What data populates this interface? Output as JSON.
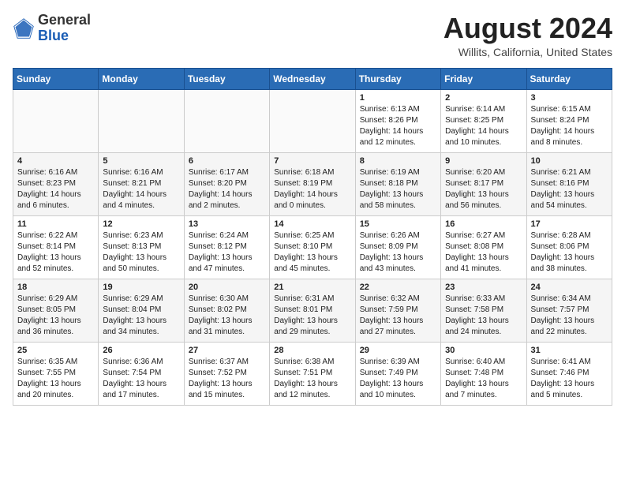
{
  "logo": {
    "general": "General",
    "blue": "Blue"
  },
  "title": "August 2024",
  "location": "Willits, California, United States",
  "days_of_week": [
    "Sunday",
    "Monday",
    "Tuesday",
    "Wednesday",
    "Thursday",
    "Friday",
    "Saturday"
  ],
  "weeks": [
    [
      {
        "day": "",
        "info": ""
      },
      {
        "day": "",
        "info": ""
      },
      {
        "day": "",
        "info": ""
      },
      {
        "day": "",
        "info": ""
      },
      {
        "day": "1",
        "info": "Sunrise: 6:13 AM\nSunset: 8:26 PM\nDaylight: 14 hours\nand 12 minutes."
      },
      {
        "day": "2",
        "info": "Sunrise: 6:14 AM\nSunset: 8:25 PM\nDaylight: 14 hours\nand 10 minutes."
      },
      {
        "day": "3",
        "info": "Sunrise: 6:15 AM\nSunset: 8:24 PM\nDaylight: 14 hours\nand 8 minutes."
      }
    ],
    [
      {
        "day": "4",
        "info": "Sunrise: 6:16 AM\nSunset: 8:23 PM\nDaylight: 14 hours\nand 6 minutes."
      },
      {
        "day": "5",
        "info": "Sunrise: 6:16 AM\nSunset: 8:21 PM\nDaylight: 14 hours\nand 4 minutes."
      },
      {
        "day": "6",
        "info": "Sunrise: 6:17 AM\nSunset: 8:20 PM\nDaylight: 14 hours\nand 2 minutes."
      },
      {
        "day": "7",
        "info": "Sunrise: 6:18 AM\nSunset: 8:19 PM\nDaylight: 14 hours\nand 0 minutes."
      },
      {
        "day": "8",
        "info": "Sunrise: 6:19 AM\nSunset: 8:18 PM\nDaylight: 13 hours\nand 58 minutes."
      },
      {
        "day": "9",
        "info": "Sunrise: 6:20 AM\nSunset: 8:17 PM\nDaylight: 13 hours\nand 56 minutes."
      },
      {
        "day": "10",
        "info": "Sunrise: 6:21 AM\nSunset: 8:16 PM\nDaylight: 13 hours\nand 54 minutes."
      }
    ],
    [
      {
        "day": "11",
        "info": "Sunrise: 6:22 AM\nSunset: 8:14 PM\nDaylight: 13 hours\nand 52 minutes."
      },
      {
        "day": "12",
        "info": "Sunrise: 6:23 AM\nSunset: 8:13 PM\nDaylight: 13 hours\nand 50 minutes."
      },
      {
        "day": "13",
        "info": "Sunrise: 6:24 AM\nSunset: 8:12 PM\nDaylight: 13 hours\nand 47 minutes."
      },
      {
        "day": "14",
        "info": "Sunrise: 6:25 AM\nSunset: 8:10 PM\nDaylight: 13 hours\nand 45 minutes."
      },
      {
        "day": "15",
        "info": "Sunrise: 6:26 AM\nSunset: 8:09 PM\nDaylight: 13 hours\nand 43 minutes."
      },
      {
        "day": "16",
        "info": "Sunrise: 6:27 AM\nSunset: 8:08 PM\nDaylight: 13 hours\nand 41 minutes."
      },
      {
        "day": "17",
        "info": "Sunrise: 6:28 AM\nSunset: 8:06 PM\nDaylight: 13 hours\nand 38 minutes."
      }
    ],
    [
      {
        "day": "18",
        "info": "Sunrise: 6:29 AM\nSunset: 8:05 PM\nDaylight: 13 hours\nand 36 minutes."
      },
      {
        "day": "19",
        "info": "Sunrise: 6:29 AM\nSunset: 8:04 PM\nDaylight: 13 hours\nand 34 minutes."
      },
      {
        "day": "20",
        "info": "Sunrise: 6:30 AM\nSunset: 8:02 PM\nDaylight: 13 hours\nand 31 minutes."
      },
      {
        "day": "21",
        "info": "Sunrise: 6:31 AM\nSunset: 8:01 PM\nDaylight: 13 hours\nand 29 minutes."
      },
      {
        "day": "22",
        "info": "Sunrise: 6:32 AM\nSunset: 7:59 PM\nDaylight: 13 hours\nand 27 minutes."
      },
      {
        "day": "23",
        "info": "Sunrise: 6:33 AM\nSunset: 7:58 PM\nDaylight: 13 hours\nand 24 minutes."
      },
      {
        "day": "24",
        "info": "Sunrise: 6:34 AM\nSunset: 7:57 PM\nDaylight: 13 hours\nand 22 minutes."
      }
    ],
    [
      {
        "day": "25",
        "info": "Sunrise: 6:35 AM\nSunset: 7:55 PM\nDaylight: 13 hours\nand 20 minutes."
      },
      {
        "day": "26",
        "info": "Sunrise: 6:36 AM\nSunset: 7:54 PM\nDaylight: 13 hours\nand 17 minutes."
      },
      {
        "day": "27",
        "info": "Sunrise: 6:37 AM\nSunset: 7:52 PM\nDaylight: 13 hours\nand 15 minutes."
      },
      {
        "day": "28",
        "info": "Sunrise: 6:38 AM\nSunset: 7:51 PM\nDaylight: 13 hours\nand 12 minutes."
      },
      {
        "day": "29",
        "info": "Sunrise: 6:39 AM\nSunset: 7:49 PM\nDaylight: 13 hours\nand 10 minutes."
      },
      {
        "day": "30",
        "info": "Sunrise: 6:40 AM\nSunset: 7:48 PM\nDaylight: 13 hours\nand 7 minutes."
      },
      {
        "day": "31",
        "info": "Sunrise: 6:41 AM\nSunset: 7:46 PM\nDaylight: 13 hours\nand 5 minutes."
      }
    ]
  ]
}
